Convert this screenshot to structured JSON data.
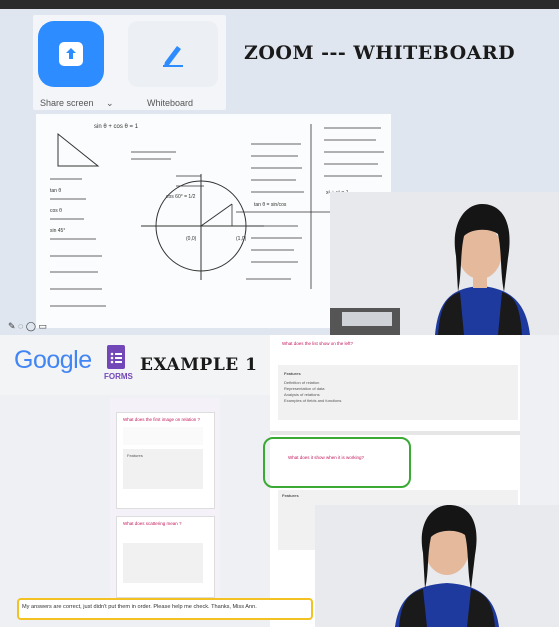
{
  "top": {
    "share_label": "Share screen",
    "whiteboard_label": "Whiteboard",
    "title": "ZOOM --- WHITEBOARD",
    "whiteboard_notes": [
      "sin θ + cos θ = 1",
      "tan θ",
      "cos θ",
      "sin 45°",
      "cos 60° = 1/2",
      "tan θ = sin/cos",
      "(0,0)",
      "(1,0)",
      "x² + y² = 1"
    ]
  },
  "bottom": {
    "google_word": "Google",
    "forms_label": "FORMS",
    "title": "EXAMPLE 1",
    "phone_q1": "What does the first image on relation ?",
    "phone_q2": "What does scattering mean ?",
    "phone_options_title": "Features",
    "wide_q1": "What does the list show on the left?",
    "wide_q2": "What does it show when it is working?",
    "wide_options_title": "Features",
    "wide_options": [
      "Definition of relation",
      "Representation of data",
      "Analysis of relations",
      "Examples of fields and functions"
    ],
    "answer_text": "My answers are correct, just didn't put them in order. Please help me check. Thanks, Miss Ann."
  }
}
